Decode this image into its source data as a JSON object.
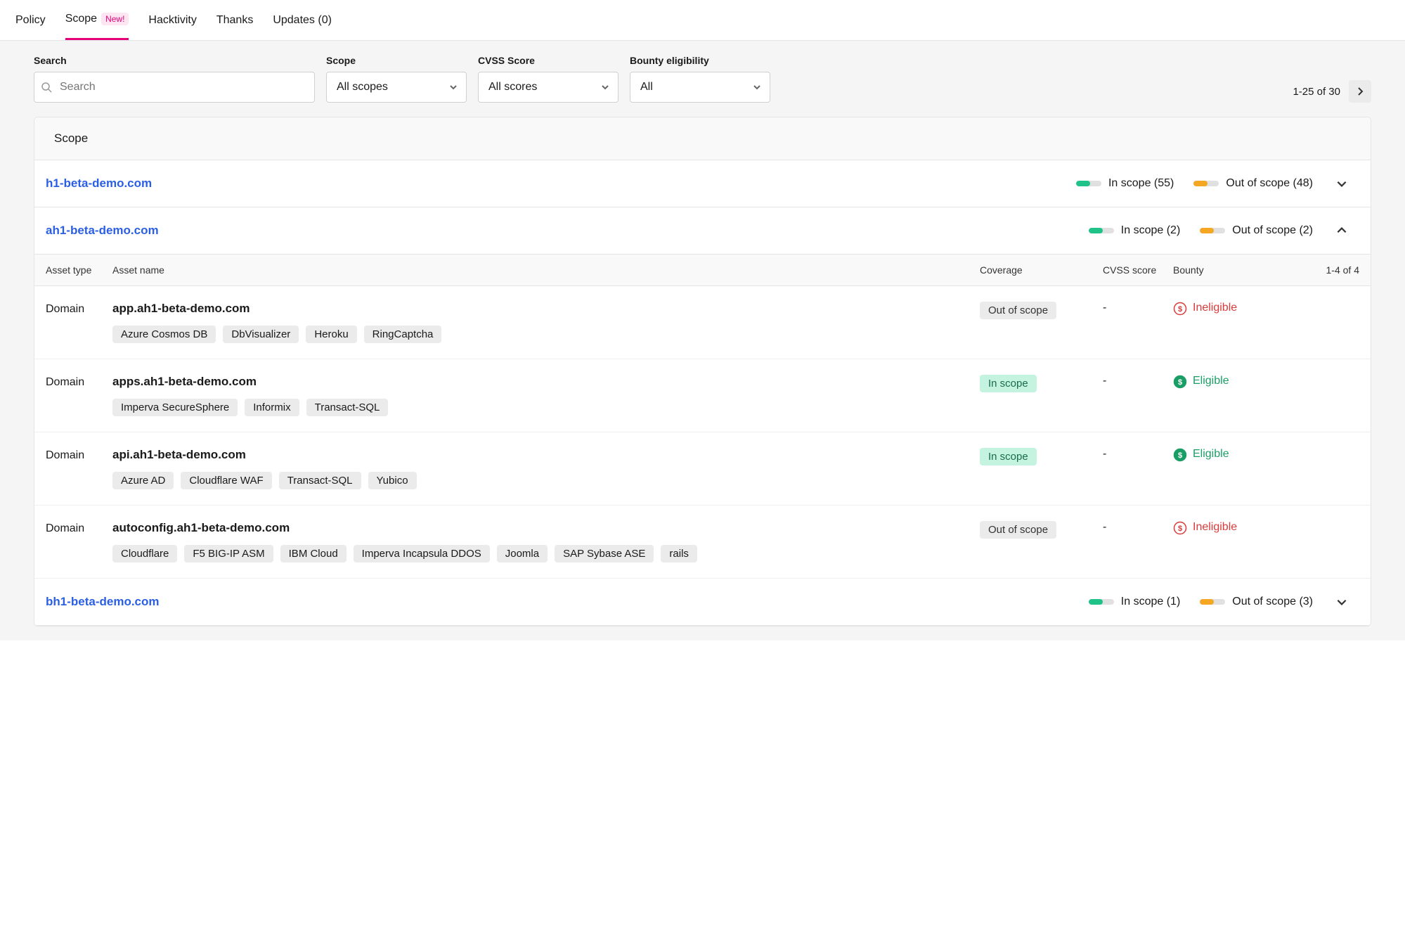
{
  "tabs": [
    {
      "label": "Policy",
      "active": false
    },
    {
      "label": "Scope",
      "active": true,
      "badge": "New!"
    },
    {
      "label": "Hacktivity",
      "active": false
    },
    {
      "label": "Thanks",
      "active": false
    },
    {
      "label": "Updates (0)",
      "active": false
    }
  ],
  "filters": {
    "search_label": "Search",
    "search_placeholder": "Search",
    "scope_label": "Scope",
    "scope_value": "All scopes",
    "cvss_label": "CVSS Score",
    "cvss_value": "All scores",
    "bounty_label": "Bounty eligibility",
    "bounty_value": "All"
  },
  "pager": {
    "summary": "1-25 of 30"
  },
  "card_title": "Scope",
  "asset_headers": {
    "type": "Asset type",
    "name": "Asset name",
    "coverage": "Coverage",
    "cvss": "CVSS score",
    "bounty": "Bounty",
    "count": "1-4 of 4"
  },
  "scopes": [
    {
      "name": "h1-beta-demo.com",
      "in_scope": "In scope (55)",
      "out_scope": "Out of scope (48)",
      "expanded": false
    },
    {
      "name": "ah1-beta-demo.com",
      "in_scope": "In scope (2)",
      "out_scope": "Out of scope (2)",
      "expanded": true,
      "assets": [
        {
          "type": "Domain",
          "name": "app.ah1-beta-demo.com",
          "coverage": "Out of scope",
          "coverage_class": "out",
          "cvss": "-",
          "bounty": "Ineligible",
          "bounty_class": "ineligible",
          "tags": [
            "Azure Cosmos DB",
            "DbVisualizer",
            "Heroku",
            "RingCaptcha"
          ]
        },
        {
          "type": "Domain",
          "name": "apps.ah1-beta-demo.com",
          "coverage": "In scope",
          "coverage_class": "in",
          "cvss": "-",
          "bounty": "Eligible",
          "bounty_class": "eligible",
          "tags": [
            "Imperva SecureSphere",
            "Informix",
            "Transact-SQL"
          ]
        },
        {
          "type": "Domain",
          "name": "api.ah1-beta-demo.com",
          "coverage": "In scope",
          "coverage_class": "in",
          "cvss": "-",
          "bounty": "Eligible",
          "bounty_class": "eligible",
          "tags": [
            "Azure AD",
            "Cloudflare WAF",
            "Transact-SQL",
            "Yubico"
          ]
        },
        {
          "type": "Domain",
          "name": "autoconfig.ah1-beta-demo.com",
          "coverage": "Out of scope",
          "coverage_class": "out",
          "cvss": "-",
          "bounty": "Ineligible",
          "bounty_class": "ineligible",
          "tags": [
            "Cloudflare",
            "F5 BIG-IP ASM",
            "IBM Cloud",
            "Imperva Incapsula DDOS",
            "Joomla",
            "SAP Sybase ASE",
            "rails"
          ]
        }
      ]
    },
    {
      "name": "bh1-beta-demo.com",
      "in_scope": "In scope (1)",
      "out_scope": "Out of scope (3)",
      "expanded": false
    }
  ]
}
